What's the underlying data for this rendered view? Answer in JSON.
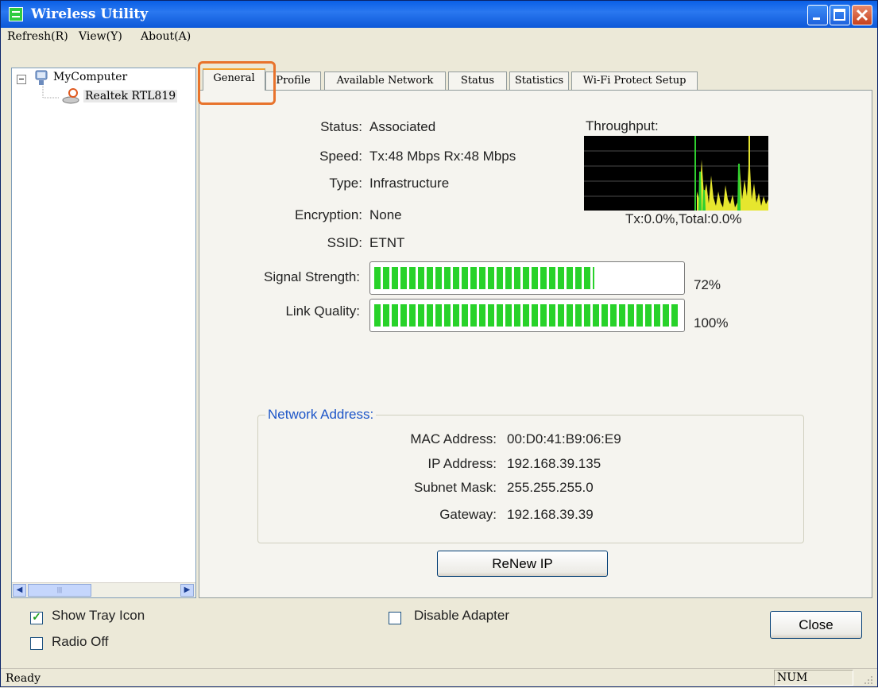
{
  "window": {
    "title": "Wireless Utility"
  },
  "menu": [
    "Refresh(R)",
    "View(Y)",
    "About(A)"
  ],
  "tree": {
    "root": "MyComputer",
    "child": "Realtek RTL819",
    "expander": "⊟"
  },
  "tabs": [
    "General",
    "Profile",
    "Available Network",
    "Status",
    "Statistics",
    "Wi-Fi Protect Setup"
  ],
  "general": {
    "status_label": "Status:",
    "status_value": "Associated",
    "speed_label": "Speed:",
    "speed_value": "Tx:48 Mbps Rx:48 Mbps",
    "type_label": "Type:",
    "type_value": "Infrastructure",
    "encryption_label": "Encryption:",
    "encryption_value": "None",
    "ssid_label": "SSID:",
    "ssid_value": "ETNT",
    "throughput_label": "Throughput:",
    "throughput_value": "Tx:0.0%,Total:0.0%",
    "signal_label": "Signal Strength:",
    "signal_percent": "72%",
    "signal_level": 0.72,
    "link_label": "Link Quality:",
    "link_percent": "100%",
    "link_level": 1.0
  },
  "network": {
    "legend": "Network Address:",
    "mac_label": "MAC Address:",
    "mac_value": "00:D0:41:B9:06:E9",
    "ip_label": "IP Address:",
    "ip_value": "192.168.39.135",
    "subnet_label": "Subnet Mask:",
    "subnet_value": "255.255.255.0",
    "gateway_label": "Gateway:",
    "gateway_value": "192.168.39.39"
  },
  "buttons": {
    "renew": "ReNew IP",
    "close": "Close"
  },
  "options": {
    "show_tray": "Show Tray Icon",
    "show_tray_checked": true,
    "radio_off": "Radio Off",
    "radio_off_checked": false,
    "disable_adapter": "Disable Adapter",
    "disable_adapter_checked": false
  },
  "statusbar": {
    "text": "Ready",
    "num": "NUM"
  },
  "colors": {
    "title_blue": "#0a5fe6",
    "signal_green": "#28d22a",
    "highlight_orange": "#e8732c",
    "legend_blue": "#1c55c8"
  }
}
